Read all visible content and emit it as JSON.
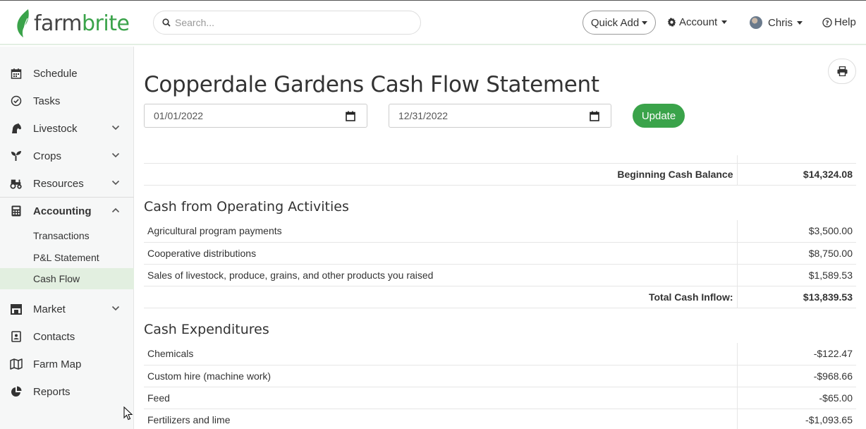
{
  "header": {
    "logo": {
      "farm": "farm",
      "brite": "brite"
    },
    "search_placeholder": "Search...",
    "quick_add": "Quick Add",
    "account": "Account",
    "user": "Chris",
    "help": "Help"
  },
  "sidebar": {
    "schedule": "Schedule",
    "tasks": "Tasks",
    "livestock": "Livestock",
    "crops": "Crops",
    "resources": "Resources",
    "accounting": "Accounting",
    "transactions": "Transactions",
    "pl_statement": "P&L Statement",
    "cash_flow": "Cash Flow",
    "market": "Market",
    "contacts": "Contacts",
    "farm_map": "Farm Map",
    "reports": "Reports"
  },
  "page": {
    "title": "Copperdale Gardens Cash Flow Statement",
    "start_date": "01/01/2022",
    "end_date": "12/31/2022",
    "update": "Update"
  },
  "statement": {
    "beginning_label": "Beginning Cash Balance",
    "beginning_value": "$14,324.08",
    "operating_heading": "Cash from Operating Activities",
    "inflows": [
      {
        "label": "Agricultural program payments",
        "amount": "$3,500.00"
      },
      {
        "label": "Cooperative distributions",
        "amount": "$8,750.00"
      },
      {
        "label": "Sales of livestock, produce, grains, and other products you raised",
        "amount": "$1,589.53"
      }
    ],
    "total_inflow_label": "Total Cash Inflow:",
    "total_inflow_value": "$13,839.53",
    "expenditures_heading": "Cash Expenditures",
    "expenditures": [
      {
        "label": "Chemicals",
        "amount": "-$122.47"
      },
      {
        "label": "Custom hire (machine work)",
        "amount": "-$968.66"
      },
      {
        "label": "Feed",
        "amount": "-$65.00"
      },
      {
        "label": "Fertilizers and lime",
        "amount": "-$1,093.65"
      }
    ]
  }
}
